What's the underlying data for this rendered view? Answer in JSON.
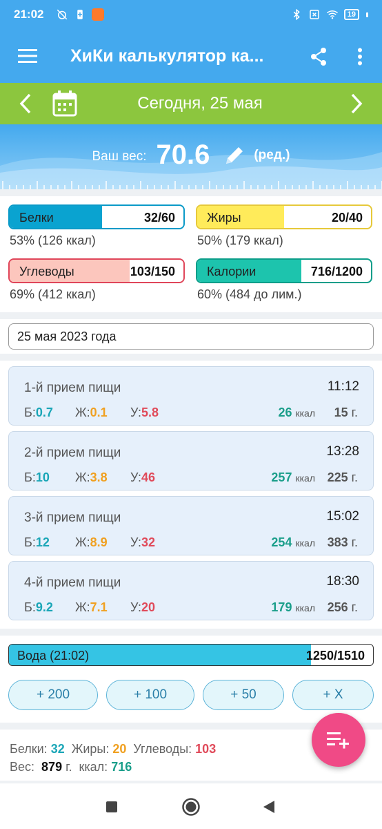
{
  "status_bar": {
    "time": "21:02",
    "battery": "19"
  },
  "app_bar": {
    "title": "ХиКи калькулятор ка..."
  },
  "date_bar": {
    "label": "Сегодня, 25 мая"
  },
  "weight": {
    "caption": "Ваш вес:",
    "value": "70.6",
    "edit_label": "(ред.)"
  },
  "macros": {
    "protein": {
      "label": "Белки",
      "value": "32/60",
      "percent_text": "53% (126 ккал)",
      "fill": 0.53,
      "color": "#0aa3d0"
    },
    "fat": {
      "label": "Жиры",
      "value": "20/40",
      "percent_text": "50% (179 ккал)",
      "fill": 0.5,
      "color": "#ffeb5a"
    },
    "carbs": {
      "label": "Углеводы",
      "value": "103/150",
      "percent_text": "69% (412 ккал)",
      "fill": 0.69,
      "color": "#fcc6bd"
    },
    "calories": {
      "label": "Калории",
      "value": "716/1200",
      "percent_text": "60% (484 до лим.)",
      "fill": 0.6,
      "color": "#1dc4ad"
    }
  },
  "date_field": {
    "value": "25 мая 2023 года"
  },
  "meals": [
    {
      "name": "1-й прием пищи",
      "time": "11:12",
      "p_label": "Б:",
      "p": "0.7",
      "f_label": "Ж:",
      "f": "0.1",
      "c_label": "У:",
      "c": "5.8",
      "kcal": "26",
      "kcal_unit": "ккал",
      "grams": "15",
      "grams_unit": "г."
    },
    {
      "name": "2-й прием пищи",
      "time": "13:28",
      "p_label": "Б:",
      "p": "10",
      "f_label": "Ж:",
      "f": "3.8",
      "c_label": "У:",
      "c": "46",
      "kcal": "257",
      "kcal_unit": "ккал",
      "grams": "225",
      "grams_unit": "г."
    },
    {
      "name": "3-й прием пищи",
      "time": "15:02",
      "p_label": "Б:",
      "p": "12",
      "f_label": "Ж:",
      "f": "8.9",
      "c_label": "У:",
      "c": "32",
      "kcal": "254",
      "kcal_unit": "ккал",
      "grams": "383",
      "grams_unit": "г."
    },
    {
      "name": "4-й прием пищи",
      "time": "18:30",
      "p_label": "Б:",
      "p": "9.2",
      "f_label": "Ж:",
      "f": "7.1",
      "c_label": "У:",
      "c": "20",
      "kcal": "179",
      "kcal_unit": "ккал",
      "grams": "256",
      "grams_unit": "г."
    }
  ],
  "water": {
    "label": "Вода (21:02)",
    "value": "1250/1510",
    "fill": 0.83,
    "buttons": [
      "+ 200",
      "+ 100",
      "+ 50",
      "+ X"
    ]
  },
  "totals": {
    "protein_label": "Белки:",
    "protein": "32",
    "fat_label": "Жиры:",
    "fat": "20",
    "carbs_label": "Углеводы:",
    "carbs": "103",
    "weight_label": "Вес:",
    "weight": "879",
    "weight_unit": "г.",
    "kcal_label": "ккал:",
    "kcal": "716"
  },
  "colors": {
    "app_bar": "#44a9ee",
    "date_bar": "#8cc63e",
    "fab": "#f04a86",
    "water_fill": "#35c4e4"
  },
  "icons": {
    "menu": "hamburger-icon",
    "share": "share-icon",
    "more": "more-vert-icon",
    "prev": "chevron-left-icon",
    "calendar": "calendar-icon",
    "next": "chevron-right-icon",
    "edit": "pencil-icon",
    "fab": "playlist-add-icon"
  }
}
